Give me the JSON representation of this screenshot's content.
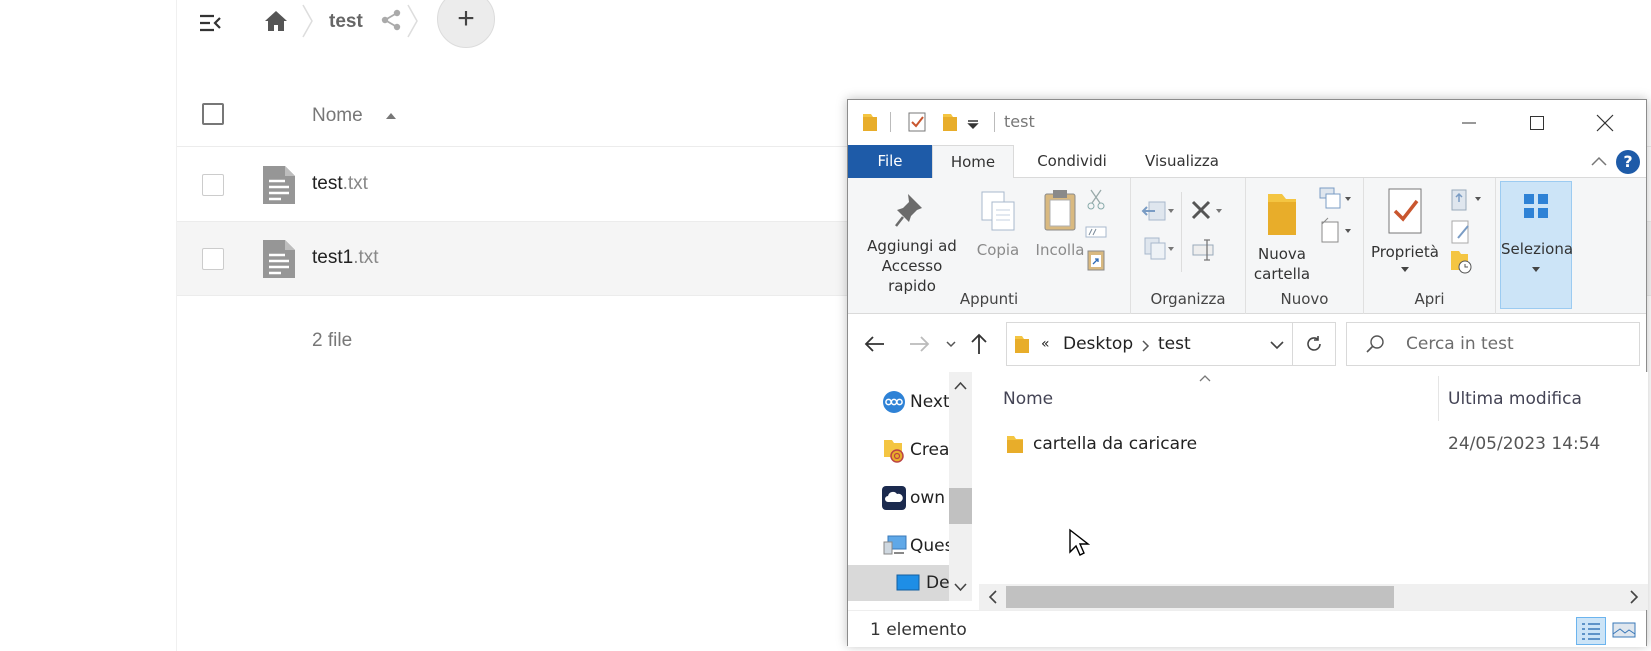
{
  "webapp": {
    "breadcrumb": {
      "folder": "test"
    },
    "add_label": "+",
    "list": {
      "column_name": "Nome",
      "files": [
        {
          "base": "test",
          "ext": ".txt"
        },
        {
          "base": "test1",
          "ext": ".txt"
        }
      ],
      "summary": "2 file"
    }
  },
  "explorer": {
    "title": "test",
    "tabs": {
      "file": "File",
      "home": "Home",
      "share": "Condividi",
      "view": "Visualizza"
    },
    "help": "?",
    "ribbon": {
      "clipboard": {
        "label": "Appunti",
        "pin_line1": "Aggiungi ad",
        "pin_line2": "Accesso rapido",
        "copy": "Copia",
        "paste": "Incolla"
      },
      "organize": {
        "label": "Organizza"
      },
      "new": {
        "label": "Nuovo",
        "folder_line1": "Nuova",
        "folder_line2": "cartella"
      },
      "open": {
        "label": "Apri",
        "properties": "Proprietà"
      },
      "select": {
        "label": "Seleziona"
      }
    },
    "address": {
      "separator": "«",
      "segment1": "Desktop",
      "segment2": "test"
    },
    "search": {
      "placeholder": "Cerca in test"
    },
    "navpane": [
      "Next",
      "Crea",
      "own",
      "Ques",
      "De"
    ],
    "columns": {
      "name": "Nome",
      "modified": "Ultima modifica"
    },
    "rows": [
      {
        "name": "cartella da caricare",
        "modified": "24/05/2023 14:54"
      }
    ],
    "status": "1 elemento",
    "colors": {
      "accent": "#1e5ba8",
      "folder": "#f4c542",
      "selection": "#cce4f7"
    }
  }
}
